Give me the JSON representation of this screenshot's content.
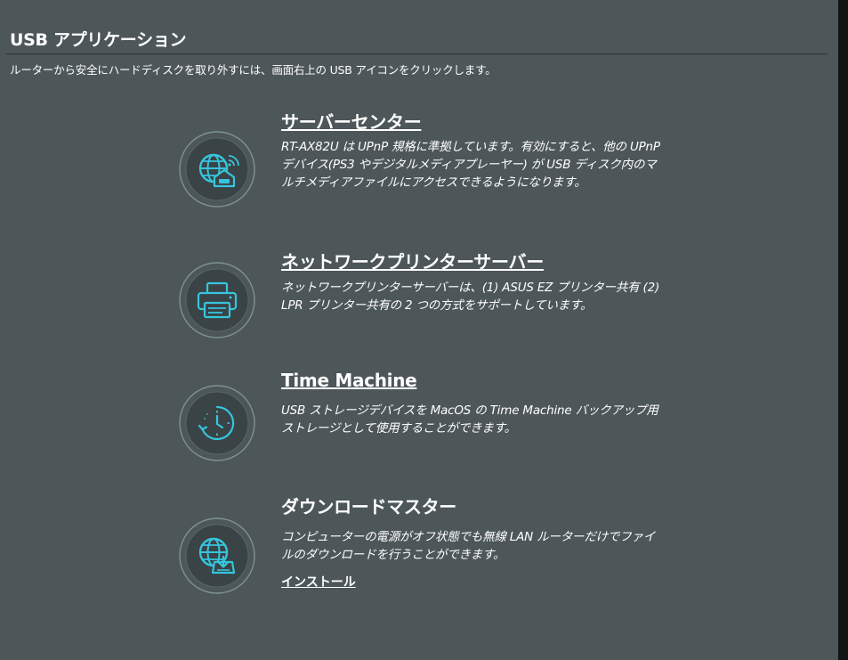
{
  "page": {
    "title": "USB アプリケーション",
    "subtitle": "ルーターから安全にハードディスクを取り外すには、画面右上の USB アイコンをクリックします。"
  },
  "apps": [
    {
      "title": "サーバーセンター",
      "description": "RT-AX82U は UPnP 規格に準拠しています。有効にすると、他の UPnP デバイス(PS3 やデジタルメディアプレーヤー) が USB ディスク内のマルチメディアファイルにアクセスできるようになります。",
      "icon": "globe-house-icon"
    },
    {
      "title": "ネットワークプリンターサーバー",
      "description": "ネットワークプリンターサーバーは、(1) ASUS EZ プリンター共有 (2) LPR プリンター共有の 2 つの方式をサポートしています。",
      "icon": "printer-icon"
    },
    {
      "title": "Time Machine",
      "description": "USB ストレージデバイスを MacOS の Time Machine バックアップ用ストレージとして使用することができます。",
      "icon": "clock-history-icon"
    },
    {
      "title": "ダウンロードマスター",
      "description": "コンピューターの電源がオフ状態でも無線 LAN ルーターだけでファイルのダウンロードを行うことができます。",
      "icon": "globe-download-icon",
      "install_label": "インストール"
    }
  ],
  "colors": {
    "background": "#4d5659",
    "icon_accent": "#35c5dd",
    "icon_ring": "#8fa4a9"
  }
}
